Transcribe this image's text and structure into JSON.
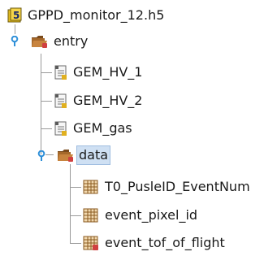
{
  "tree": {
    "root": {
      "label": "GPPD_monitor_12.h5",
      "icon": "hdf5-file-icon"
    },
    "entry": {
      "label": "entry",
      "icon": "folder-open-icon",
      "expanded": true,
      "children": [
        {
          "label": "GEM_HV_1",
          "icon": "text-dataset-icon"
        },
        {
          "label": "GEM_HV_2",
          "icon": "text-dataset-icon"
        },
        {
          "label": "GEM_gas",
          "icon": "text-dataset-icon"
        }
      ]
    },
    "data": {
      "label": "data",
      "icon": "folder-open-icon",
      "expanded": true,
      "selected": true,
      "children": [
        {
          "label": "T0_PusleID_EventNum",
          "icon": "table-dataset-icon"
        },
        {
          "label": "event_pixel_id",
          "icon": "table-dataset-icon"
        },
        {
          "label": "event_tof_of_flight",
          "icon": "table-dataset-icon"
        }
      ]
    }
  },
  "colors": {
    "selection": "#cfe0f3",
    "selection_border": "#9fbde0",
    "lines": "#9a9a9a",
    "handle": "#2e8fd8",
    "folder": "#a5682a",
    "file_badge": "#e8c020"
  }
}
